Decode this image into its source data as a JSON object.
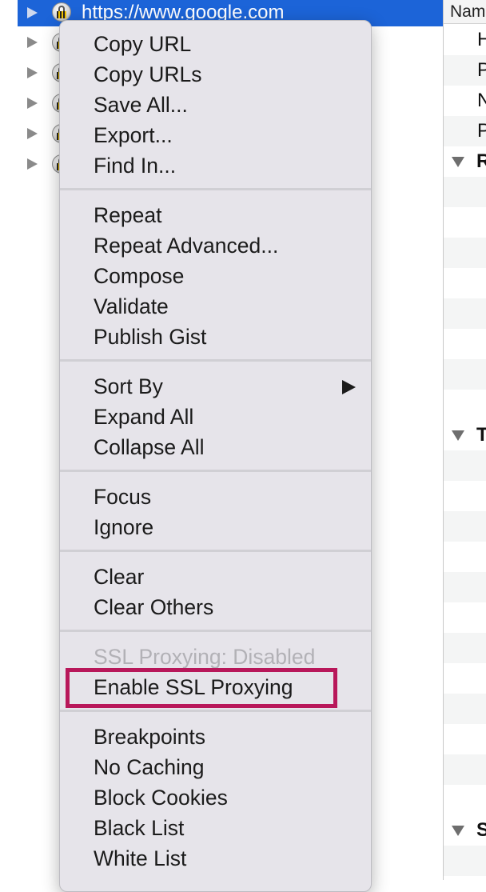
{
  "tree": {
    "selected_host": "https://www.google.com",
    "row_icon": "lock-icon",
    "expander_icon": "disclosure-triangle-icon"
  },
  "overview": {
    "column_header": "Nam",
    "cells": [
      "H",
      "P",
      "N",
      "P"
    ],
    "sections": [
      "R",
      "T",
      "S"
    ]
  },
  "menu": {
    "groups": [
      [
        "Copy URL",
        "Copy URLs",
        "Save All...",
        "Export...",
        "Find In..."
      ],
      [
        "Repeat",
        "Repeat Advanced...",
        "Compose",
        "Validate",
        "Publish Gist"
      ],
      [
        "Sort By",
        "Expand All",
        "Collapse All"
      ],
      [
        "Focus",
        "Ignore"
      ],
      [
        "Clear",
        "Clear Others"
      ],
      [
        "SSL Proxying: Disabled",
        "Enable SSL Proxying"
      ],
      [
        "Breakpoints",
        "No Caching",
        "Block Cookies",
        "Black List",
        "White List"
      ]
    ],
    "disabled_item": "SSL Proxying: Disabled",
    "submenu_item": "Sort By",
    "highlighted_item": "Enable SSL Proxying"
  },
  "colors": {
    "selection": "#1c64d8",
    "menu_background": "#e6e4ea",
    "highlight_box": "#b8175a",
    "disabled_text": "#b2b1b6"
  }
}
